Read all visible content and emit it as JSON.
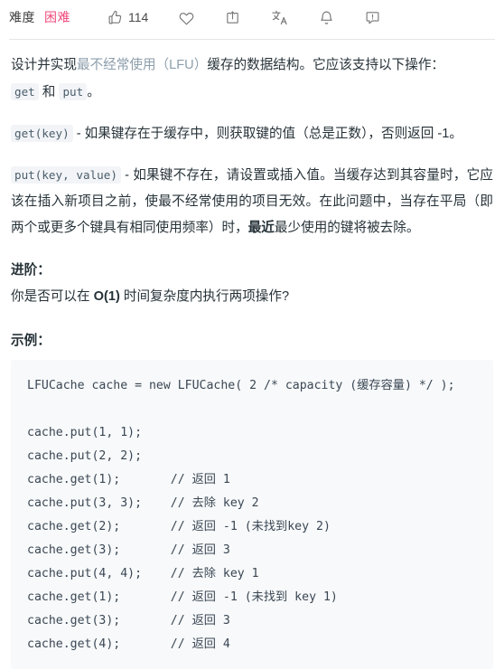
{
  "toolbar": {
    "difficulty_label": "难度",
    "difficulty_value": "困难",
    "difficulty_color": "#ef4b7c",
    "actions": [
      {
        "name": "thumbs-up",
        "icon": "thumbs-up-icon",
        "count": "114"
      },
      {
        "name": "favorite",
        "icon": "heart-icon",
        "count": ""
      },
      {
        "name": "share",
        "icon": "share-icon",
        "count": ""
      },
      {
        "name": "translate",
        "icon": "translate-icon",
        "count": ""
      },
      {
        "name": "notification",
        "icon": "bell-icon",
        "count": ""
      },
      {
        "name": "feedback",
        "icon": "comment-alert-icon",
        "count": ""
      }
    ]
  },
  "description": {
    "intro_before_link": "设计并实现",
    "intro_link": "最不经常使用（LFU）",
    "intro_after_link": "缓存的数据结构。它应该支持以下操作：",
    "intro_code_1": "get",
    "intro_mid": " 和 ",
    "intro_code_2": "put",
    "intro_end": "。",
    "get_code": "get(key)",
    "get_text": " - 如果键存在于缓存中，则获取键的值（总是正数），否则返回 -1。",
    "put_code": "put(key, value)",
    "put_text_1": " - 如果键不存在，请设置或插入值。当缓存达到其容量时，它应该在插入新项目之前，使最不经常使用的项目无效。在此问题中，当存在平局（即两个或更多个键具有相同使用频率）时，",
    "put_bold": "最近",
    "put_text_2": "最少使用的键将被去除。"
  },
  "followup": {
    "heading": "进阶：",
    "text_before": "你是否可以在 ",
    "bold": "O(1)",
    "text_after": " 时间复杂度内执行两项操作?"
  },
  "example": {
    "heading": "示例：",
    "code": "LFUCache cache = new LFUCache( 2 /* capacity (缓存容量) */ );\n\ncache.put(1, 1);\ncache.put(2, 2);\ncache.get(1);       // 返回 1\ncache.put(3, 3);    // 去除 key 2\ncache.get(2);       // 返回 -1 (未找到key 2)\ncache.get(3);       // 返回 3\ncache.put(4, 4);    // 去除 key 1\ncache.get(1);       // 返回 -1 (未找到 key 1)\ncache.get(3);       // 返回 3\ncache.get(4);       // 返回 4"
  }
}
